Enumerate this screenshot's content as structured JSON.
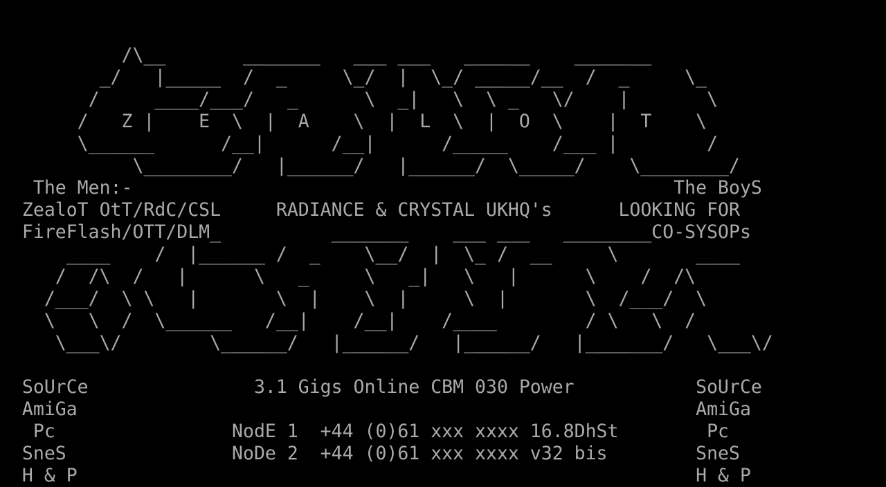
{
  "screen": {
    "foreground": "#aaaaaa",
    "background": "#000000",
    "lines": [
      "",
      "           /\\__       _______   ___ ___   ______    _______",
      "         _/   |_____  /  _     \\_/  |  \\_/ _____/__  /  _     \\_",
      "        /     ____/___/   _      \\  _|   \\  \\ _   \\/    |       \\",
      "       /   Z |    E  \\  |  A    \\  |  L  \\  |  O  \\    |  T    \\",
      "       \\______      /__|      /__|      /_____    /___ |        /",
      "            \\________/   |______/   |______/  \\_____/    \\________/",
      "   The Men:-                                                 The BoyS",
      "  ZealoT OtT/RdC/CSL     RADIANCE & CRYSTAL UKHQ's      LOOKING FOR",
      "  FireFlash/OTT/DLM_          _______    ___ ___   ________CO-SYSOPs",
      "      ____    /  |______ /  _    \\__/  |  \\_ /  __     \\       ____",
      "     /  /\\  /   |      \\   _     \\   _|   \\   |      \\    /  /\\",
      "    /___/  \\ \\   |       \\  |    \\  |     \\  |       \\  /___/  \\",
      "    \\   \\  /  \\______   /__|    /__|    /____        / \\   \\  /",
      "     \\___\\/        \\______/   |______/   |______/   |_______/   \\___\\/",
      "",
      "  SoUrCe               3.1 Gigs Online CBM 030 Power           SoUrCe",
      "  AmiGa                                                        AmiGa",
      "   Pc                NodE 1  +44 (0)61 xxx xxxx 16.8DhSt        Pc",
      "  SneS               NoDe 2  +44 (0)61 xxx xxxx v32 bis        SneS",
      "  H & P                                                        H & P"
    ]
  }
}
